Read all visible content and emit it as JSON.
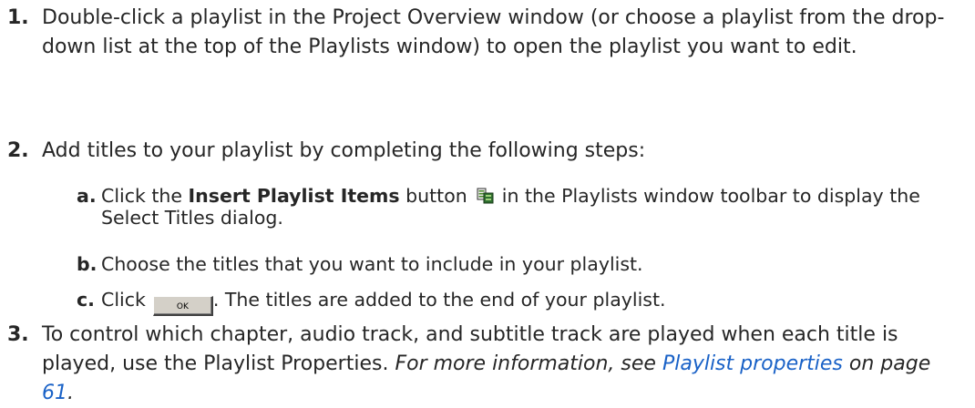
{
  "steps": [
    {
      "number": "1.",
      "text": "Double-click a playlist in the Project Overview window (or choose a playlist from the drop-down list at the top of the Playlists window) to open the playlist you want to edit."
    },
    {
      "number": "2.",
      "text": "Add titles to your playlist by completing the following steps:",
      "substeps": [
        {
          "letter": "a.",
          "pre": "Click the ",
          "bold": "Insert Playlist Items",
          "mid": " button",
          "post": "in the Playlists window toolbar to display the Select Titles dialog.",
          "icon": "insert-playlist-items-icon"
        },
        {
          "letter": "b.",
          "text": "Choose the titles that you want to include in your playlist."
        },
        {
          "letter": "c.",
          "pre": "Click",
          "button_label": "OK",
          "post": ". The titles are added to the end of your playlist."
        }
      ]
    },
    {
      "number": "3.",
      "text": "To control which chapter, audio track, and subtitle track are played when each title is played, use the Playlist Properties. ",
      "italic_pre": "For more information, see ",
      "link": "Playlist properties",
      "italic_mid": " on page ",
      "page_link": "61",
      "end": "."
    }
  ]
}
